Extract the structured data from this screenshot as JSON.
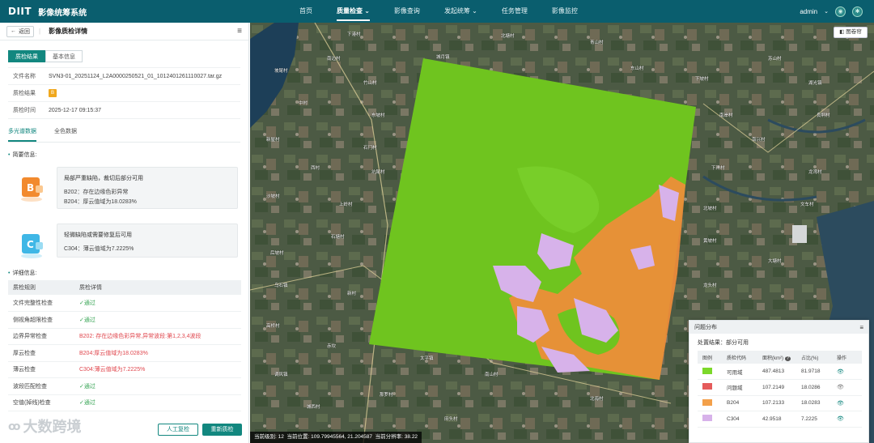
{
  "app": {
    "logo": "DIIT",
    "title": "影像统筹系统"
  },
  "nav": [
    {
      "label": "首页",
      "dropdown": false,
      "active": false
    },
    {
      "label": "质量检查",
      "dropdown": true,
      "active": true
    },
    {
      "label": "影像查询",
      "dropdown": false,
      "active": false
    },
    {
      "label": "发起统筹",
      "dropdown": true,
      "active": false
    },
    {
      "label": "任务管理",
      "dropdown": false,
      "active": false
    },
    {
      "label": "影像监控",
      "dropdown": false,
      "active": false
    }
  ],
  "user": {
    "name": "admin"
  },
  "panel": {
    "back_label": "返回",
    "title": "影像质检详情",
    "tabs": [
      "质检结果",
      "基本信息"
    ],
    "info": {
      "file_label": "文件名称",
      "file_value": "SVN3-01_20251124_L2A0000250521_01_1012401261110027.tar.gz",
      "result_label": "质检结果",
      "result_value": "B",
      "time_label": "质检时间",
      "time_value": "2025-12-17 09:15:37"
    },
    "data_tabs": [
      "多光谱数据",
      "全色数据"
    ],
    "summary_title": "简要信息:",
    "summary": [
      {
        "icon_letter": "B",
        "color": "#f28a2e",
        "title": "局部严重缺陷，裁切后部分可用",
        "lines": [
          "B202：存在边缘色彩异常",
          "B204：厚云值域为18.0283%"
        ]
      },
      {
        "icon_letter": "C",
        "color": "#3fb7e6",
        "title": "轻微缺陷或需要修复后可用",
        "lines": [
          "C304：薄云值域为7.2225%"
        ]
      }
    ],
    "detail_title": "详细信息:",
    "detail_headers": [
      "质检规则",
      "质检详情"
    ],
    "detail_rows": [
      {
        "rule": "文件完整性检查",
        "detail": "✓通过",
        "status": "ok"
      },
      {
        "rule": "侧视角超限检查",
        "detail": "✓通过",
        "status": "ok"
      },
      {
        "rule": "边界异常检查",
        "detail": "B202: 存在边缘色彩异常,异常波段:第1,2,3,4波段",
        "status": "err"
      },
      {
        "rule": "厚云检查",
        "detail": "B204:厚云值域为18.0283%",
        "status": "err"
      },
      {
        "rule": "薄云检查",
        "detail": "C304:薄云值域为7.2225%",
        "status": "err"
      },
      {
        "rule": "波段匹配检查",
        "detail": "✓通过",
        "status": "ok"
      },
      {
        "rule": "空值(掉线)检查",
        "detail": "✓通过",
        "status": "ok"
      }
    ],
    "btn_manual": "人工复检",
    "btn_recheck": "重新质检",
    "watermark": "大数跨境"
  },
  "map": {
    "layer_button": "图卷帘",
    "status": {
      "level_label": "当前级别:",
      "level": "12",
      "pos_label": "当前位置:",
      "pos": "109.79945564, 21.204587",
      "res_label": "当前分辨率:",
      "res": "38.22"
    },
    "places": [
      "下港村",
      "北塘村",
      "青山村",
      "南边村",
      "城月镇",
      "坡尾村",
      "东山村",
      "竹山村",
      "苏山村",
      "下坡村",
      "湖光镇",
      "中村",
      "东坡村",
      "南岸村",
      "良垌村",
      "新屋村",
      "石门村",
      "南兴村",
      "西村",
      "坑尾村",
      "下洋村",
      "龙湾村",
      "沙坡村",
      "上岭村",
      "北坡村",
      "文车村",
      "石塘村",
      "后坡村",
      "黄坡村",
      "大塘村",
      "乌石镇",
      "新村",
      "龙头村",
      "高桥村",
      "赤坎",
      "太平镇",
      "南山村",
      "调风镇",
      "那罗村",
      "北海村",
      "城西村",
      "田头村"
    ]
  },
  "issues": {
    "title": "问题分布",
    "result_label": "处置结果：",
    "result_value": "部分可用",
    "headers": [
      "图例",
      "质检代码",
      "面积(km²)",
      "占比(%)",
      "操作"
    ],
    "rows": [
      {
        "color": "#7cd82a",
        "code": "可用域",
        "area": "487.4813",
        "pct": "81.9718"
      },
      {
        "color": "#e55b5b",
        "code": "问题域",
        "area": "107.2149",
        "pct": "18.0286"
      },
      {
        "color": "#f3a04a",
        "code": "B204",
        "area": "107.2133",
        "pct": "18.0283"
      },
      {
        "color": "#d7b2ea",
        "code": "C304",
        "area": "42.9518",
        "pct": "7.2225"
      }
    ]
  }
}
